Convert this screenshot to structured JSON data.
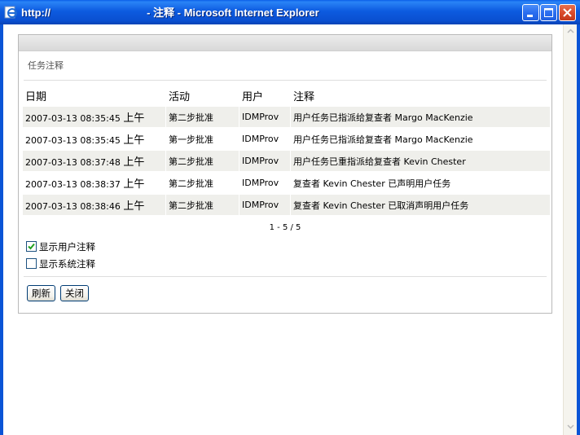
{
  "window": {
    "title_left": "http://",
    "title_right": "- 注释 - Microsoft Internet Explorer"
  },
  "panel": {
    "caption": "任务注释"
  },
  "table": {
    "headers": [
      "日期",
      "活动",
      "用户",
      "注释"
    ],
    "rows": [
      {
        "date": "2007-03-13 08:35:45",
        "ampm": "上午",
        "activity": "第二步批准",
        "user": "IDMProv",
        "note": "用户任务已指派给复查者 Margo MacKenzie"
      },
      {
        "date": "2007-03-13 08:35:45",
        "ampm": "上午",
        "activity": "第一步批准",
        "user": "IDMProv",
        "note": "用户任务已指派给复查者 Margo MacKenzie"
      },
      {
        "date": "2007-03-13 08:37:48",
        "ampm": "上午",
        "activity": "第二步批准",
        "user": "IDMProv",
        "note": "用户任务已重指派给复查者 Kevin Chester"
      },
      {
        "date": "2007-03-13 08:38:37",
        "ampm": "上午",
        "activity": "第二步批准",
        "user": "IDMProv",
        "note": "复查者 Kevin Chester 已声明用户任务"
      },
      {
        "date": "2007-03-13 08:38:46",
        "ampm": "上午",
        "activity": "第二步批准",
        "user": "IDMProv",
        "note": "复查者 Kevin Chester 已取消声明用户任务"
      }
    ]
  },
  "pager": "1 - 5 / 5",
  "options": {
    "show_user_notes": {
      "label": "显示用户注释",
      "checked": true
    },
    "show_system_notes": {
      "label": "显示系统注释",
      "checked": false
    }
  },
  "buttons": {
    "refresh": "刷新",
    "close": "关闭"
  },
  "colors": {
    "titlebar": "#0a54d6",
    "row_alt": "#efefeb",
    "checkmark": "#21a121"
  }
}
